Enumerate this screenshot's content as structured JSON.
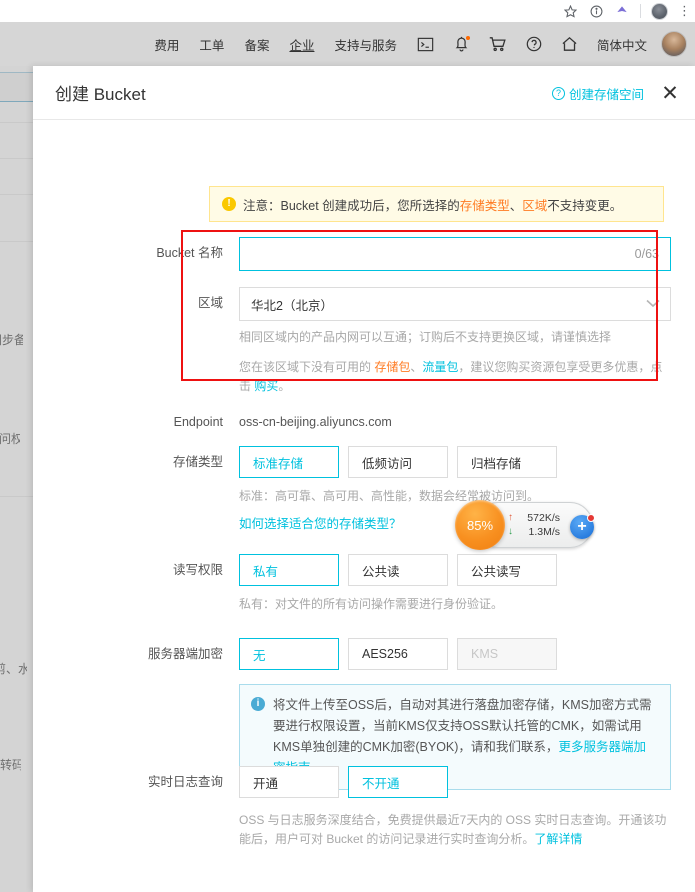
{
  "browser": {
    "icons": [
      "bookmark-star-icon",
      "info-icon",
      "extension-icon",
      "profile-avatar-icon",
      "menu-dots-icon"
    ],
    "menu_dots": "⋮"
  },
  "topnav": {
    "items": [
      {
        "label": "费用",
        "underlined": false
      },
      {
        "label": "工单",
        "underlined": false
      },
      {
        "label": "备案",
        "underlined": false
      },
      {
        "label": "企业",
        "underlined": true
      },
      {
        "label": "支持与服务",
        "underlined": false
      }
    ],
    "icons": [
      "terminal-icon",
      "bell-icon",
      "cart-icon",
      "help-circle-icon",
      "home-icon"
    ],
    "language": "简体中文",
    "avatar": "user-avatar"
  },
  "background": {
    "fragments": [
      "同步备份",
      "访问权限",
      "剪、水",
      "据转码"
    ]
  },
  "modal": {
    "title": "创建 Bucket",
    "help_link": "创建存储空间",
    "help_icon_glyph": "?",
    "close_glyph": "✕"
  },
  "warning": {
    "icon_glyph": "!",
    "text_1": "注意：Bucket 创建成功后，您所选择的",
    "highlight_1": "存储类型",
    "separator": "、",
    "highlight_2": "区域",
    "text_2": "不支持变更。"
  },
  "form": {
    "bucket_name": {
      "label": "Bucket 名称",
      "value": "",
      "placeholder": "",
      "counter": "0/63"
    },
    "region": {
      "label": "区域",
      "value": "华北2（北京）",
      "chevron": "chevron-down-icon",
      "hint": "相同区域内的产品内网可以互通；订购后不支持更换区域，请谨慎选择",
      "notice_1": "您在该区域下没有可用的 ",
      "notice_hl_1": "存储包",
      "notice_sep": "、",
      "notice_hl_2": "流量包",
      "notice_2": "，建议您购买资源包享受更多优惠，点击 ",
      "notice_link": "购买",
      "notice_3": "。"
    },
    "endpoint": {
      "label": "Endpoint",
      "value": "oss-cn-beijing.aliyuncs.com"
    },
    "storage_class": {
      "label": "存储类型",
      "options": [
        {
          "label": "标准存储",
          "selected": true,
          "disabled": false
        },
        {
          "label": "低频访问",
          "selected": false,
          "disabled": false
        },
        {
          "label": "归档存储",
          "selected": false,
          "disabled": false
        }
      ],
      "hint": "标准：高可靠、高可用、高性能，数据会经常被访问到。",
      "link": "如何选择适合您的存储类型？"
    },
    "acl": {
      "label": "读写权限",
      "options": [
        {
          "label": "私有",
          "selected": true,
          "disabled": false
        },
        {
          "label": "公共读",
          "selected": false,
          "disabled": false
        },
        {
          "label": "公共读写",
          "selected": false,
          "disabled": false
        }
      ],
      "hint": "私有：对文件的所有访问操作需要进行身份验证。"
    },
    "encryption": {
      "label": "服务器端加密",
      "options": [
        {
          "label": "无",
          "selected": true,
          "disabled": false
        },
        {
          "label": "AES256",
          "selected": false,
          "disabled": false
        },
        {
          "label": "KMS",
          "selected": false,
          "disabled": true
        }
      ],
      "info_icon_glyph": "i",
      "info_text": "将文件上传至OSS后，自动对其进行落盘加密存储，KMS加密方式需要进行权限设置，当前KMS仅支持OSS默认托管的CMK，如需试用KMS单独创建的CMK加密(BYOK)，请和我们联系，",
      "info_link": "更多服务器端加密指南"
    },
    "realtime_log": {
      "label": "实时日志查询",
      "options": [
        {
          "label": "开通",
          "selected": false,
          "disabled": false
        },
        {
          "label": "不开通",
          "selected": true,
          "disabled": false
        }
      ],
      "hint": "OSS 与日志服务深度结合，免费提供最近7天内的 OSS 实时日志查询。开通该功能后，用户可对 Bucket 的访问记录进行实时查询分析。",
      "hint_link": "了解详情"
    }
  },
  "net_widget": {
    "percent": "85%",
    "upload_rate": "572K/s",
    "download_rate": "1.3M/s",
    "upload_arrow": "↑",
    "download_arrow": "↓",
    "plus_glyph": "+"
  },
  "colors": {
    "accent_cyan": "#00c1de",
    "warn_bg": "#fffbe6",
    "warn_border": "#ffe58f",
    "warn_icon": "#fac800",
    "highlight_orange": "#ff7b23",
    "annotation_red": "#ee1111",
    "info_border": "#a9dcec",
    "topnav_bg": "#d6d6d6"
  }
}
